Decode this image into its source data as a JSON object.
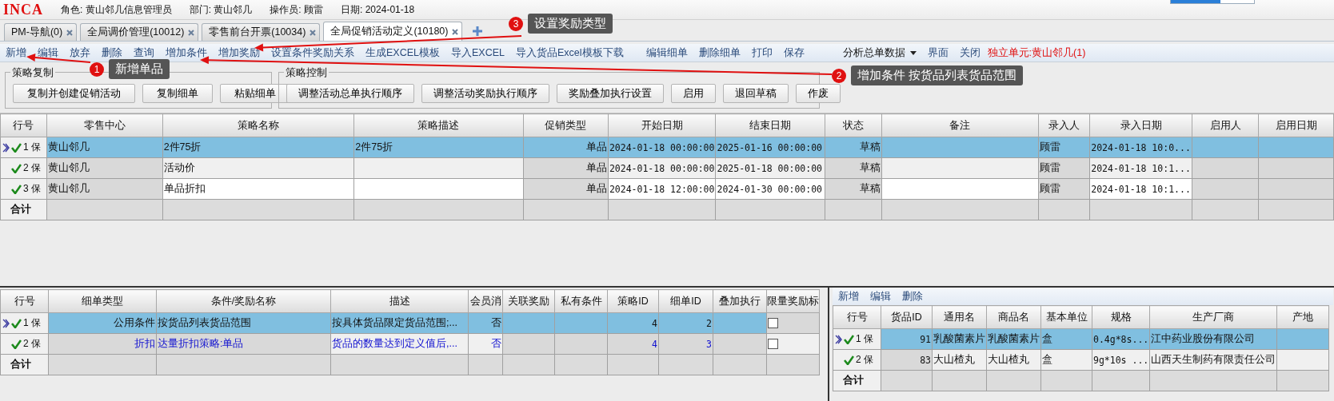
{
  "header": {
    "logo": "INCA",
    "fields": [
      "角色: 黄山邻几信息管理员",
      "部门: 黄山邻几",
      "操作员: 顾雷",
      "日期: 2024-01-18"
    ]
  },
  "tabs": [
    {
      "label": "PM-导航(0)",
      "selected": false
    },
    {
      "label": "全局调价管理(10012)",
      "selected": false
    },
    {
      "label": "零售前台开票(10034)",
      "selected": false
    },
    {
      "label": "全局促销活动定义(10180)",
      "selected": true
    }
  ],
  "toolbar": [
    [
      {
        "label": "新增",
        "kind": "action"
      },
      {
        "label": "编辑",
        "kind": "action"
      },
      {
        "label": "放弃",
        "kind": "action"
      },
      {
        "label": "删除",
        "kind": "action"
      },
      {
        "label": "查询",
        "kind": "action"
      },
      {
        "label": "增加条件",
        "kind": "action"
      },
      {
        "label": "增加奖励",
        "kind": "action"
      },
      {
        "label": "设置条件奖励关系",
        "kind": "action"
      },
      {
        "label": "生成EXCEL模板",
        "kind": "action"
      },
      {
        "label": "导入EXCEL",
        "kind": "action"
      },
      {
        "label": "导入货品Excel模板下载",
        "kind": "action"
      }
    ],
    [
      {
        "label": "编辑细单",
        "kind": "action"
      },
      {
        "label": "删除细单",
        "kind": "action"
      },
      {
        "label": "打印",
        "kind": "action"
      },
      {
        "label": "保存",
        "kind": "action"
      }
    ],
    [
      {
        "label": "分析总单数据",
        "kind": "dropdown"
      },
      {
        "label": "界面",
        "kind": "action"
      },
      {
        "label": "关闭",
        "kind": "action"
      },
      {
        "label": "独立单元:黄山邻几(1)",
        "kind": "notice"
      }
    ]
  ],
  "group_boxes": [
    {
      "title": "策略复制",
      "buttons": [
        "复制并创建促销活动",
        "复制细单",
        "粘贴细单"
      ]
    },
    {
      "title": "策略控制",
      "buttons": [
        "调整活动总单执行顺序",
        "调整活动奖励执行顺序",
        "奖励叠加执行设置",
        "启用",
        "退回草稿",
        "作废"
      ]
    }
  ],
  "strategy_table": {
    "columns": [
      {
        "label": "行号"
      },
      {
        "label": "零售中心",
        "locked": true
      },
      {
        "label": "策略名称",
        "locked": false
      },
      {
        "label": "策略描述",
        "locked": false
      },
      {
        "label": "促销类型",
        "locked": true
      },
      {
        "label": "开始日期",
        "locked": false
      },
      {
        "label": "结束日期",
        "locked": false
      },
      {
        "label": "状态",
        "locked": true
      },
      {
        "label": "备注",
        "locked": false
      },
      {
        "label": "录入人",
        "locked": true
      },
      {
        "label": "录入日期",
        "locked": false
      },
      {
        "label": "启用人",
        "locked": true
      },
      {
        "label": "启用日期",
        "locked": true
      }
    ],
    "rows": [
      {
        "selected": true,
        "valid": true,
        "cells": [
          "1 保",
          "黄山邻几",
          "2件75折",
          "2件75折",
          "单品",
          "2024-01-18 00:00:00",
          "2025-01-16 00:00:00",
          "草稿",
          null,
          "顾雷",
          "2024-01-18 10:0...",
          null,
          null
        ]
      },
      {
        "selected": false,
        "valid": true,
        "cells": [
          "2 保",
          "黄山邻几",
          "活动价",
          null,
          "单品",
          "2024-01-18 00:00:00",
          "2025-01-18 00:00:00",
          "草稿",
          null,
          "顾雷",
          "2024-01-18 10:1...",
          null,
          null
        ]
      },
      {
        "selected": false,
        "valid": true,
        "cells": [
          "3 保",
          "黄山邻几",
          "单品折扣",
          null,
          "单品",
          "2024-01-18 12:00:00",
          "2024-01-30 00:00:00",
          "草稿",
          null,
          "顾雷",
          "2024-01-18 10:1...",
          null,
          null
        ]
      }
    ],
    "total_label": "合计"
  },
  "detail_table": {
    "columns": [
      {
        "label": "行号"
      },
      {
        "label": "细单类型",
        "locked": true,
        "kind": "text"
      },
      {
        "label": "条件/奖励名称",
        "locked": true,
        "kind": "text"
      },
      {
        "label": "描述",
        "locked": false,
        "kind": "text"
      },
      {
        "label": "会员消",
        "locked": false,
        "kind": "text"
      },
      {
        "label": "关联奖励",
        "locked": true,
        "kind": "text"
      },
      {
        "label": "私有条件",
        "locked": true,
        "kind": "text"
      },
      {
        "label": "策略ID",
        "locked": true,
        "kind": "text"
      },
      {
        "label": "细单ID",
        "locked": true,
        "kind": "text"
      },
      {
        "label": "叠加执行",
        "locked": true,
        "kind": "text"
      },
      {
        "label": "限量奖励标",
        "kind": "checkbox"
      }
    ],
    "rows": [
      {
        "selected": true,
        "valid": true,
        "kind": "condition",
        "cells": [
          "1 保",
          "公用条件",
          "按货品列表货品范围",
          "按具体货品限定货品范围;...",
          "否",
          null,
          null,
          "4",
          "2",
          null
        ],
        "limit_flag": false
      },
      {
        "selected": false,
        "valid": true,
        "kind": "reward",
        "cells": [
          "2 保",
          "折扣",
          "达量折扣策略:单品",
          "货品的数量达到定义值后,...",
          "否",
          null,
          null,
          "4",
          "3",
          null
        ],
        "limit_flag": false
      }
    ],
    "total_label": "合计"
  },
  "goods_panel": {
    "toolbar": [
      "新增",
      "编辑",
      "删除"
    ],
    "columns": [
      {
        "label": "行号"
      },
      {
        "label": "货品ID",
        "locked": true
      },
      {
        "label": "通用名",
        "locked": false
      },
      {
        "label": "商品名",
        "locked": false
      },
      {
        "label": "基本单位",
        "locked": false
      },
      {
        "label": "规格",
        "locked": false
      },
      {
        "label": "生产厂商",
        "locked": false
      },
      {
        "label": "产地",
        "locked": false
      }
    ],
    "rows": [
      {
        "selected": true,
        "valid": true,
        "cells": [
          "1 保",
          "91",
          "乳酸菌素片",
          "乳酸菌素片",
          "盒",
          "0.4g*8s...",
          "江中药业股份有限公司",
          null
        ]
      },
      {
        "selected": false,
        "valid": true,
        "cells": [
          "2 保",
          "83",
          "大山楂丸",
          "大山楂丸",
          "盒",
          "9g*10s ...",
          "山西天生制药有限责任公司",
          null
        ]
      }
    ],
    "total_label": "合计"
  },
  "callouts": [
    {
      "number": "1",
      "text": "新增单品"
    },
    {
      "number": "2",
      "text": "增加条件 按货品列表货品范围"
    },
    {
      "number": "3",
      "text": "设置奖励类型"
    }
  ]
}
